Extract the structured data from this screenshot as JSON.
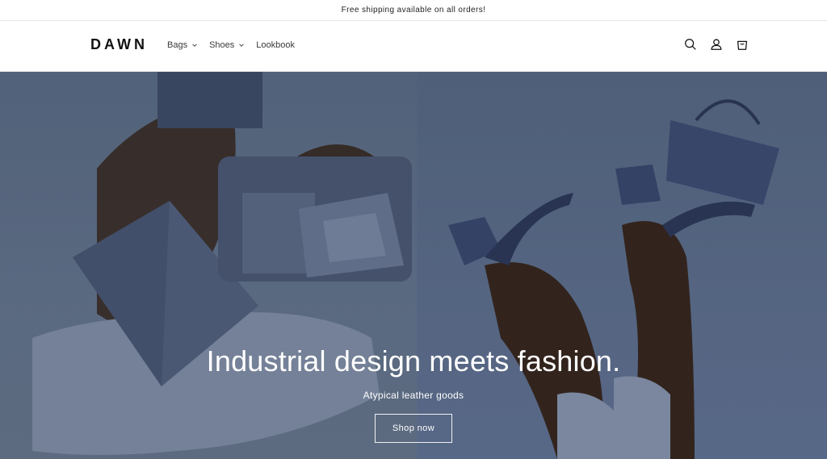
{
  "announcement": {
    "text": "Free shipping available on all orders!"
  },
  "header": {
    "logo": "DAWN",
    "nav": [
      {
        "label": "Bags",
        "has_dropdown": true
      },
      {
        "label": "Shoes",
        "has_dropdown": true
      },
      {
        "label": "Lookbook",
        "has_dropdown": false
      }
    ],
    "icons": [
      "search-icon",
      "account-icon",
      "cart-icon"
    ]
  },
  "hero": {
    "title": "Industrial design meets fashion.",
    "subtitle": "Atypical leather goods",
    "button_label": "Shop now"
  },
  "colors": {
    "text": "#121212",
    "hero_bg": "#5d6f8a",
    "hero_text": "#ffffff"
  }
}
